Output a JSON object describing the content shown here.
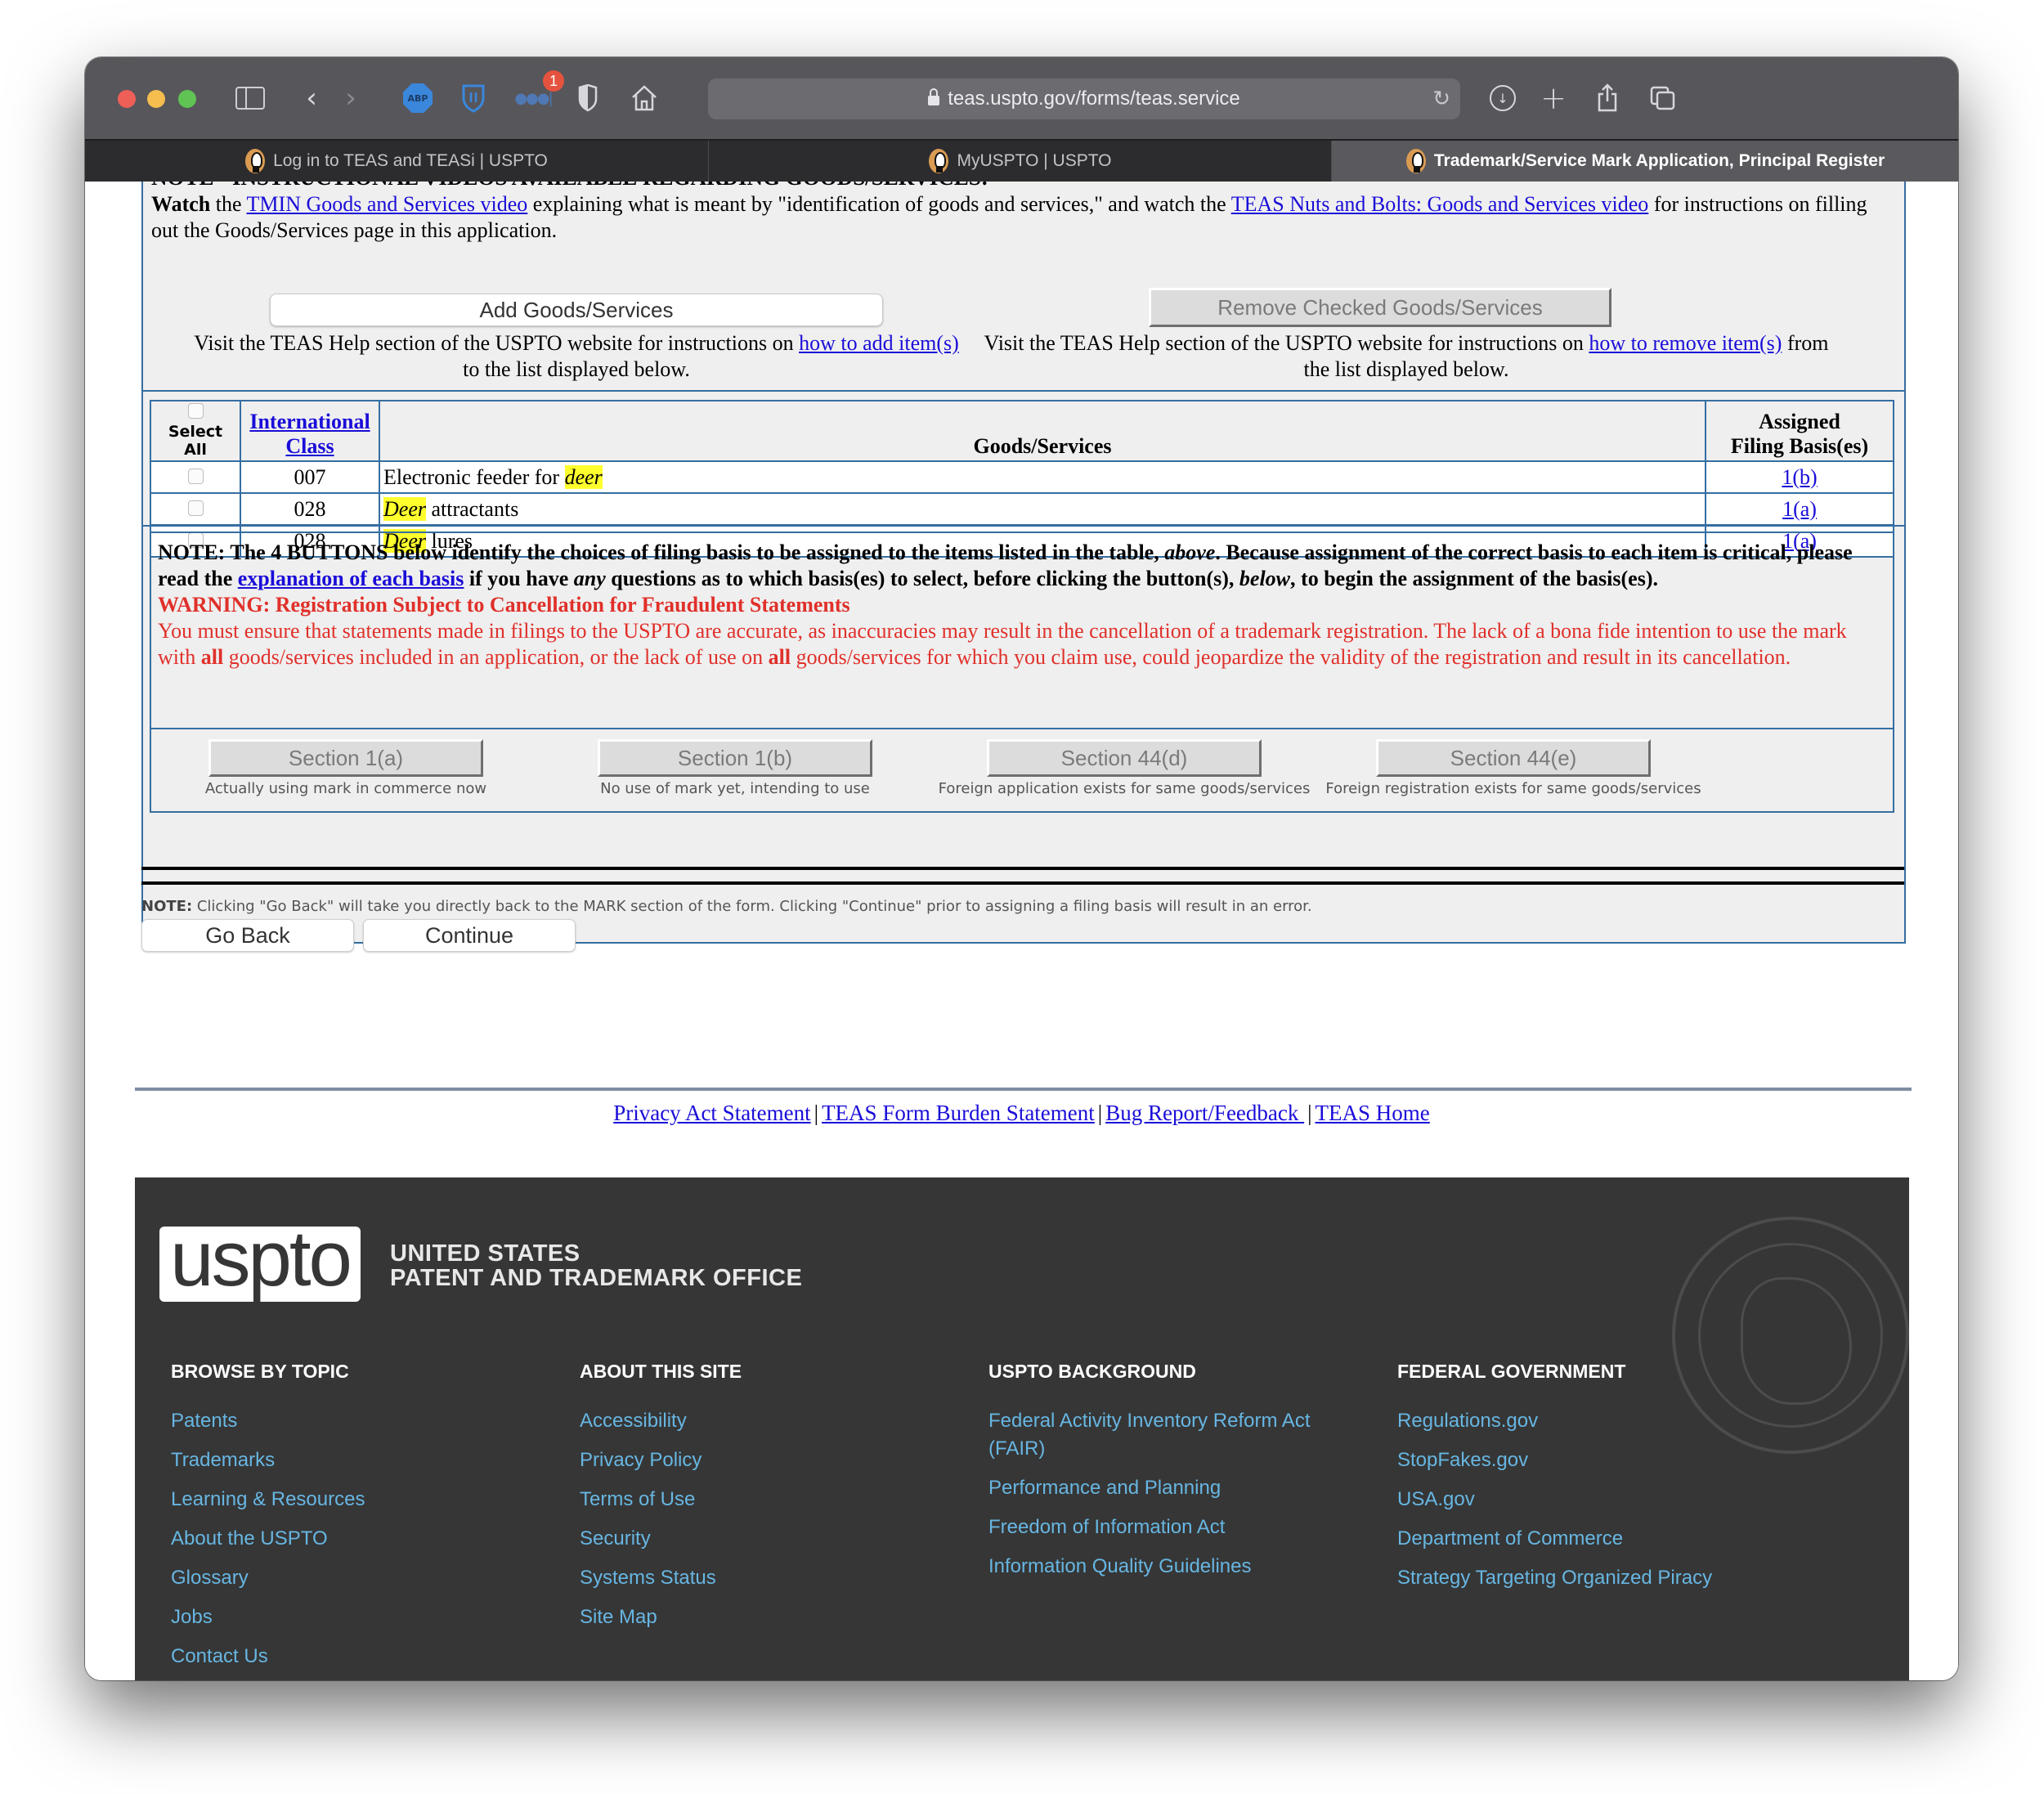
{
  "browser": {
    "url": "teas.uspto.gov/forms/teas.service",
    "extension_badge": "1",
    "toolbar_icons": [
      "sidebar-icon",
      "back-icon",
      "forward-icon",
      "adblock-plus-icon",
      "bitwarden-icon",
      "extension-dots-icon",
      "privacy-shield-icon",
      "home-icon",
      "reload-icon",
      "download-icon",
      "new-tab-icon",
      "share-icon",
      "tab-overview-icon"
    ],
    "tabs": [
      {
        "label": "Log in to TEAS and TEASi | USPTO",
        "active": false
      },
      {
        "label": "MyUSPTO | USPTO",
        "active": false
      },
      {
        "label": "Trademark/Service Mark Application, Principal Register",
        "active": true
      }
    ]
  },
  "instructions": {
    "clipped_heading": "NOTE - INSTRUCTIONAL VIDEOS AVAILABLE REGARDING GOODS/SERVICES:",
    "watch_bold": "Watch",
    "watch_the": " the ",
    "tmin_link": "TMIN Goods and Services video",
    "watch_mid": " explaining what is meant by \"identification of goods and services,\" and watch the ",
    "nuts_link": "TEAS Nuts and Bolts: Goods and Services video",
    "watch_end": " for instructions on filling out the Goods/Services page in this application."
  },
  "actions": {
    "add_label": "Add Goods/Services",
    "remove_label": "Remove Checked Goods/Services",
    "add_help_pre": "Visit the TEAS Help section of the USPTO website for instructions on ",
    "add_help_link": "how to add item(s)",
    "add_help_post": " to the list displayed below.",
    "remove_help_pre": "Visit the TEAS Help section of the USPTO website for instructions on ",
    "remove_help_link": "how to remove item(s)",
    "remove_help_post": " from the list displayed below."
  },
  "table": {
    "headers": {
      "select_all": "Select All",
      "intl_class_line1": "International",
      "intl_class_line2": "Class",
      "goods": "Goods/Services",
      "basis_line1": "Assigned",
      "basis_line2": "Filing Basis(es)"
    },
    "rows": [
      {
        "checked": false,
        "class": "007",
        "pre": "Electronic feeder for ",
        "highlight": "deer",
        "post": "",
        "basis": "1(b)"
      },
      {
        "checked": false,
        "class": "028",
        "pre": "",
        "highlight": "Deer",
        "post": " attractants",
        "basis": "1(a)"
      },
      {
        "checked": false,
        "class": "028",
        "pre": "",
        "highlight": "Deer",
        "post": " lures",
        "basis": "1(a)"
      }
    ]
  },
  "note": {
    "p1": "NOTE: The 4 BUTTONS below identify the choices of filing basis to be assigned to the items listed in the table, ",
    "p1_em": "above",
    "p2": ". Because assignment of the correct basis to each item is critical, please read the ",
    "link": "explanation of each basis",
    "p3": " if you have ",
    "p3_em": "any",
    "p4": " questions as to which basis(es) to select, before clicking the button(s), ",
    "p4_em": "below",
    "p5": ", to begin the assignment of the basis(es).",
    "warning_heading": "WARNING: Registration Subject to Cancellation for Fraudulent Statements",
    "w1": "You must ensure that statements made in filings to the USPTO are accurate, as inaccuracies may result in the cancellation of a trademark registration. The lack of a bona fide intention to use the mark with ",
    "w_all1": "all",
    "w2": " goods/services included in an application, or the lack of use on ",
    "w_all2": "all",
    "w3": " goods/services for which you claim use, could jeopardize the validity of the registration and result in its cancellation."
  },
  "basis_buttons": [
    {
      "label": "Section 1(a)",
      "desc": "Actually using mark in commerce now"
    },
    {
      "label": "Section 1(b)",
      "desc": "No use of mark yet, intending to use"
    },
    {
      "label": "Section 44(d)",
      "desc": "Foreign application exists for same goods/services"
    },
    {
      "label": "Section 44(e)",
      "desc": "Foreign registration exists for same goods/services"
    }
  ],
  "navigation": {
    "note_bold": "NOTE:",
    "note_text": " Clicking \"Go Back\" will take you directly back to the MARK section of the form. Clicking \"Continue\" prior to assigning a filing basis will result in an error.",
    "go_back": "Go Back",
    "continue": "Continue"
  },
  "footer_links": [
    "Privacy Act Statement",
    "TEAS Form Burden Statement",
    "Bug Report/Feedback ",
    "TEAS Home"
  ],
  "site_footer": {
    "logo": "uspto",
    "logo_line1": "UNITED STATES",
    "logo_line2": "PATENT AND TRADEMARK OFFICE",
    "columns": [
      {
        "title": "BROWSE BY TOPIC",
        "links": [
          "Patents",
          "Trademarks",
          "Learning & Resources",
          "About the USPTO",
          "Glossary",
          "Jobs",
          "Contact Us"
        ]
      },
      {
        "title": "ABOUT THIS SITE",
        "links": [
          "Accessibility",
          "Privacy Policy",
          "Terms of Use",
          "Security",
          "Systems Status",
          "Site Map"
        ]
      },
      {
        "title": "USPTO BACKGROUND",
        "links": [
          "Federal Activity Inventory Reform Act (FAIR)",
          "Performance and Planning",
          "Freedom of Information Act",
          "Information Quality Guidelines"
        ]
      },
      {
        "title": "FEDERAL GOVERNMENT",
        "links": [
          "Regulations.gov",
          "StopFakes.gov",
          "USA.gov",
          "Department of Commerce",
          "Strategy Targeting Organized Piracy"
        ]
      }
    ]
  },
  "colors": {
    "link": "#1a0dd8",
    "warning": "#e0302a",
    "border_blue": "#356ea1",
    "highlight": "#ffff2e",
    "footer_bg": "#363636",
    "footer_link": "#67b6e2"
  }
}
